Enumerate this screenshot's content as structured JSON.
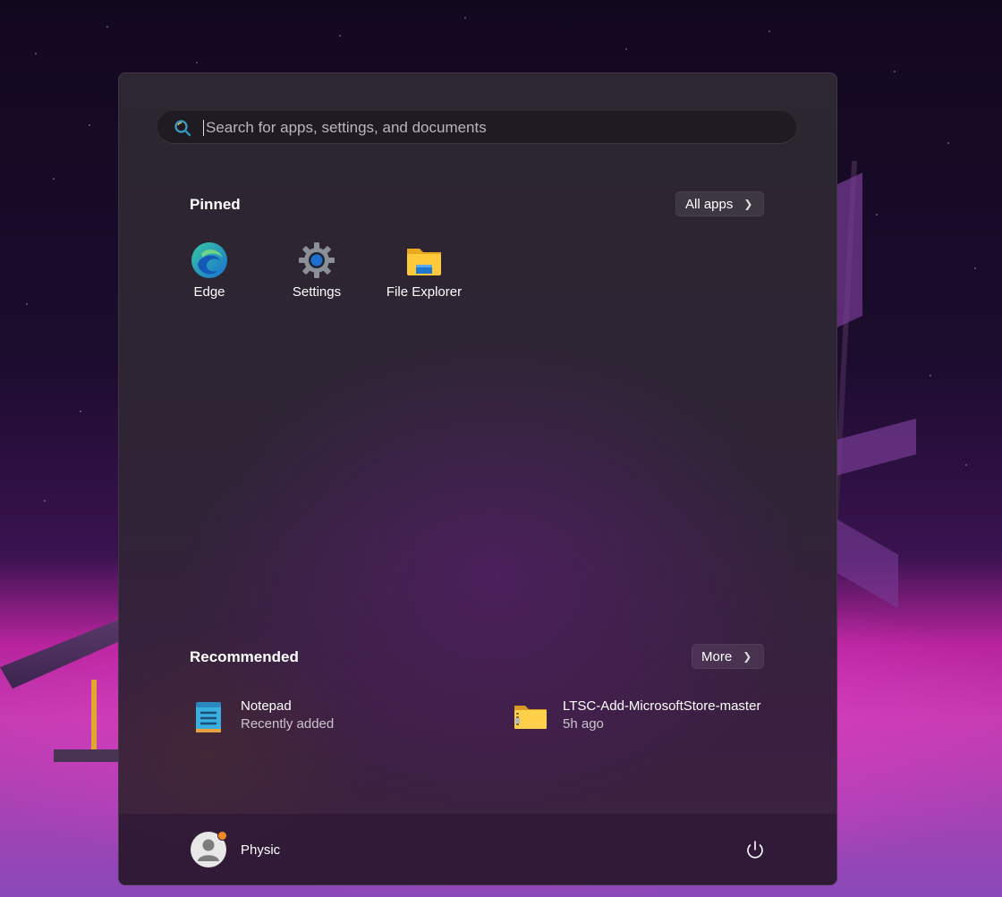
{
  "search": {
    "placeholder": "Search for apps, settings, and documents"
  },
  "pinned": {
    "title": "Pinned",
    "all_apps_label": "All apps",
    "apps": [
      {
        "label": "Edge",
        "icon": "edge-icon"
      },
      {
        "label": "Settings",
        "icon": "gear-icon"
      },
      {
        "label": "File Explorer",
        "icon": "folder-icon"
      }
    ]
  },
  "recommended": {
    "title": "Recommended",
    "more_label": "More",
    "items": [
      {
        "name": "Notepad",
        "sub": "Recently added",
        "icon": "notepad-icon"
      },
      {
        "name": "LTSC-Add-MicrosoftStore-master",
        "sub": "5h ago",
        "icon": "zip-folder-icon"
      }
    ]
  },
  "user": {
    "name": "Physic"
  },
  "colors": {
    "accent_badge": "#f08a24",
    "search_lens": "#3aa0c8"
  }
}
